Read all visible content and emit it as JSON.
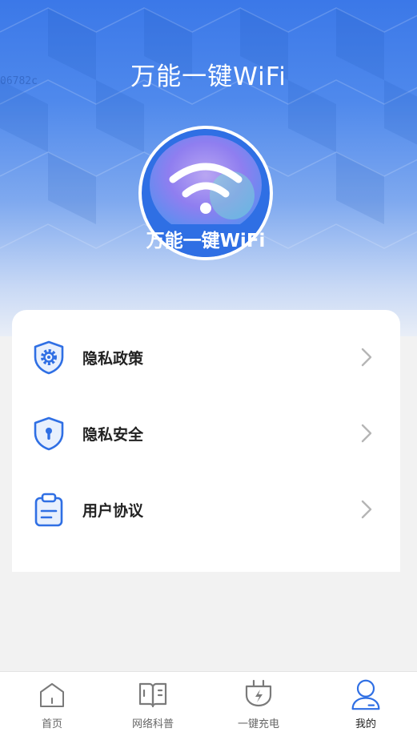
{
  "app": {
    "title": "万能一键WiFi",
    "watermark": "06782c"
  },
  "logo": {
    "badge_text": "万能一键WiFi"
  },
  "menu": {
    "items": [
      {
        "label": "隐私政策",
        "icon": "shield-gear-icon"
      },
      {
        "label": "隐私安全",
        "icon": "shield-lock-icon"
      },
      {
        "label": "用户协议",
        "icon": "clipboard-icon"
      }
    ]
  },
  "tabbar": {
    "active_index": 3,
    "items": [
      {
        "label": "首页",
        "icon": "home-icon"
      },
      {
        "label": "网络科普",
        "icon": "book-icon"
      },
      {
        "label": "一键充电",
        "icon": "charge-plug-icon"
      },
      {
        "label": "我的",
        "icon": "user-icon"
      }
    ]
  },
  "colors": {
    "accent": "#2f6fe4",
    "hero_top": "#3b78e8",
    "text_primary": "#222222",
    "tab_inactive": "#666666"
  }
}
